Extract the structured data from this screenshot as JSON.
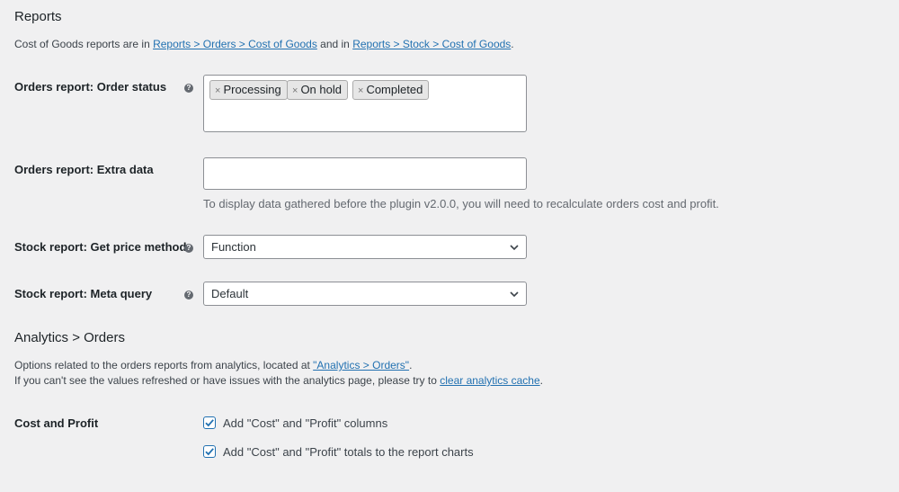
{
  "reports": {
    "title": "Reports",
    "desc_prefix": "Cost of Goods reports are in ",
    "link1": "Reports > Orders > Cost of Goods",
    "desc_mid": " and in ",
    "link2": "Reports > Stock > Cost of Goods",
    "desc_suffix": "."
  },
  "order_status": {
    "label": "Orders report: Order status",
    "help_icon": "question-circle-icon",
    "tags": [
      "Processing",
      "On hold",
      "Completed"
    ],
    "remove_glyph": "×"
  },
  "extra_data": {
    "label": "Orders report: Extra data",
    "value": "",
    "note": "To display data gathered before the plugin v2.0.0, you will need to recalculate orders cost and profit."
  },
  "stock_price": {
    "label": "Stock report: Get price method",
    "selected": "Function"
  },
  "stock_meta": {
    "label": "Stock report: Meta query",
    "selected": "Default"
  },
  "analytics": {
    "title": "Analytics > Orders",
    "line1_prefix": "Options related to the orders reports from analytics, located at ",
    "line1_link": "\"Analytics > Orders\"",
    "line1_suffix": ".",
    "line2_prefix": "If you can't see the values refreshed or have issues with the analytics page, please try to ",
    "line2_link": "clear analytics cache",
    "line2_suffix": "."
  },
  "cost_profit": {
    "label": "Cost and Profit",
    "checkbox1": "Add \"Cost\" and \"Profit\" columns",
    "checkbox2": "Add \"Cost\" and \"Profit\" totals to the report charts",
    "checked1": true,
    "checked2": true
  },
  "colors": {
    "link": "#2271b1",
    "background": "#f0f0f1",
    "text": "#1d2327"
  }
}
